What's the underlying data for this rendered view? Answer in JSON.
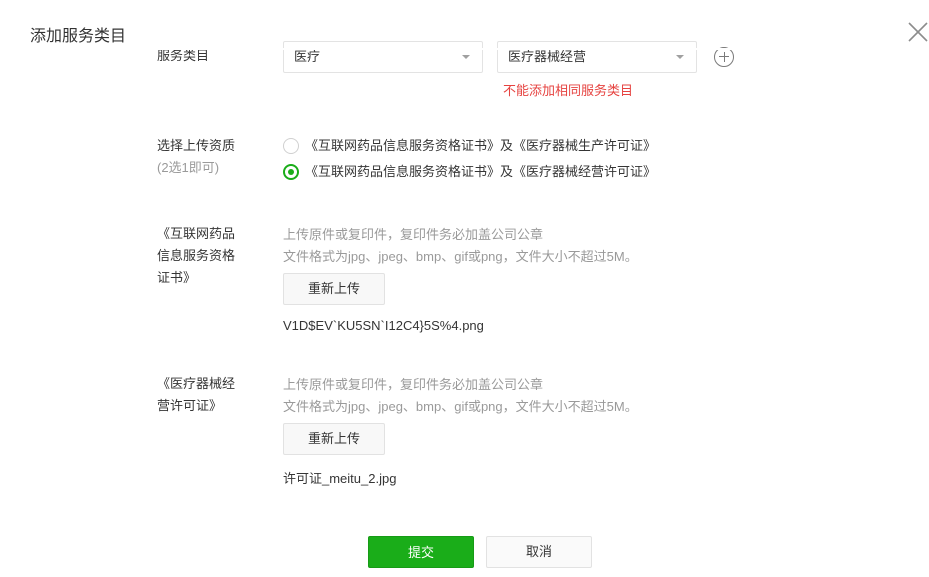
{
  "dialog": {
    "title": "添加服务类目",
    "close_icon": "close-icon"
  },
  "service_category": {
    "label": "服务类目",
    "primary_select_value": "医疗",
    "secondary_select_value": "医疗器械经营",
    "add_icon": "plus-circle-icon",
    "error_text": "不能添加相同服务类目"
  },
  "qualification": {
    "label": "选择上传资质",
    "label_sub": "(2选1即可)",
    "options": [
      {
        "label": "《互联网药品信息服务资格证书》及《医疗器械生产许可证》",
        "checked": false
      },
      {
        "label": "《互联网药品信息服务资格证书》及《医疗器械经营许可证》",
        "checked": true
      }
    ]
  },
  "uploads": [
    {
      "label_lines": [
        "《互联网药品",
        "信息服务资格",
        "证书》"
      ],
      "hint_line1": "上传原件或复印件，复印件务必加盖公司公章",
      "hint_line2": "文件格式为jpg、jpeg、bmp、gif或png，文件大小不超过5M。",
      "button_label": "重新上传",
      "filename": "V1D$EV`KU5SN`I12C4}5S%4.png"
    },
    {
      "label_lines": [
        "《医疗器械经",
        "营许可证》"
      ],
      "hint_line1": "上传原件或复印件，复印件务必加盖公司公章",
      "hint_line2": "文件格式为jpg、jpeg、bmp、gif或png，文件大小不超过5M。",
      "button_label": "重新上传",
      "filename": "许可证_meitu_2.jpg"
    }
  ],
  "actions": {
    "submit_label": "提交",
    "cancel_label": "取消"
  },
  "colors": {
    "primary": "#1aad19",
    "error": "#e64340",
    "hint": "#9a9a9a"
  }
}
